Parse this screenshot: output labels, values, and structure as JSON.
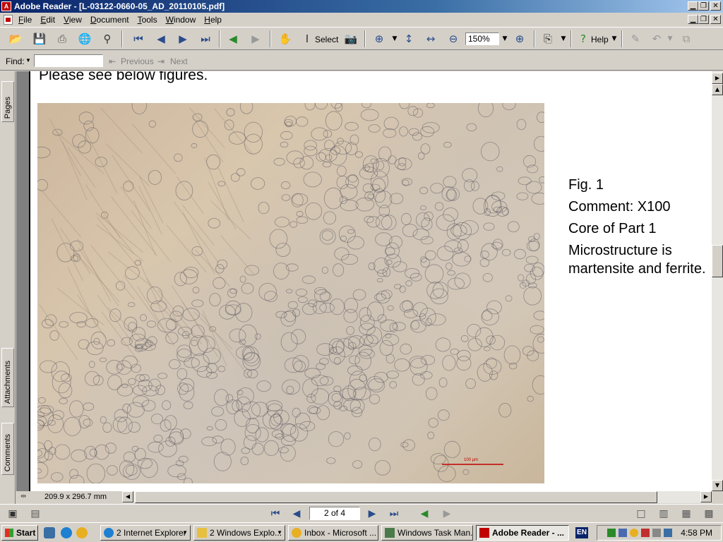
{
  "window": {
    "title": "Adobe Reader - [L-03122-0660-05_AD_20110105.pdf]",
    "app_icon": "adobe-reader-icon"
  },
  "menubar": {
    "items": [
      "File",
      "Edit",
      "View",
      "Document",
      "Tools",
      "Window",
      "Help"
    ]
  },
  "toolbar": {
    "select_label": "Select",
    "zoom_value": "150%",
    "help_label": "Help"
  },
  "findbar": {
    "find_label": "Find:",
    "find_value": "",
    "previous_label": "Previous",
    "next_label": "Next"
  },
  "nav_panel": {
    "tabs": [
      "Pages",
      "Attachments",
      "Comments"
    ]
  },
  "document": {
    "intro_text": "Please see below figures.",
    "figure": {
      "scale_bar_label": "100 µm"
    },
    "caption": {
      "fig": "Fig. 1",
      "comment": "Comment: X100",
      "part": "Core of Part 1",
      "micro": "Microstructure is martensite and ferrite."
    }
  },
  "status": {
    "page_size": "209.9 x 296.7 mm"
  },
  "pagenav": {
    "page_value": "2 of 4"
  },
  "taskbar": {
    "start_label": "Start",
    "tasks": [
      {
        "label": "2 Internet Explorer",
        "icon": "internet-explorer-icon"
      },
      {
        "label": "2 Windows Explo...",
        "icon": "folder-icon"
      },
      {
        "label": "Inbox - Microsoft ...",
        "icon": "outlook-icon"
      },
      {
        "label": "Windows Task Man...",
        "icon": "task-manager-icon"
      },
      {
        "label": "Adobe Reader - ...",
        "icon": "adobe-reader-icon"
      }
    ],
    "language": "EN",
    "clock": "4:58 PM"
  },
  "colors": {
    "titlebar_start": "#0a246a",
    "titlebar_end": "#a6caf0",
    "chrome": "#d4d0c8",
    "scale_bar": "#c00000"
  }
}
